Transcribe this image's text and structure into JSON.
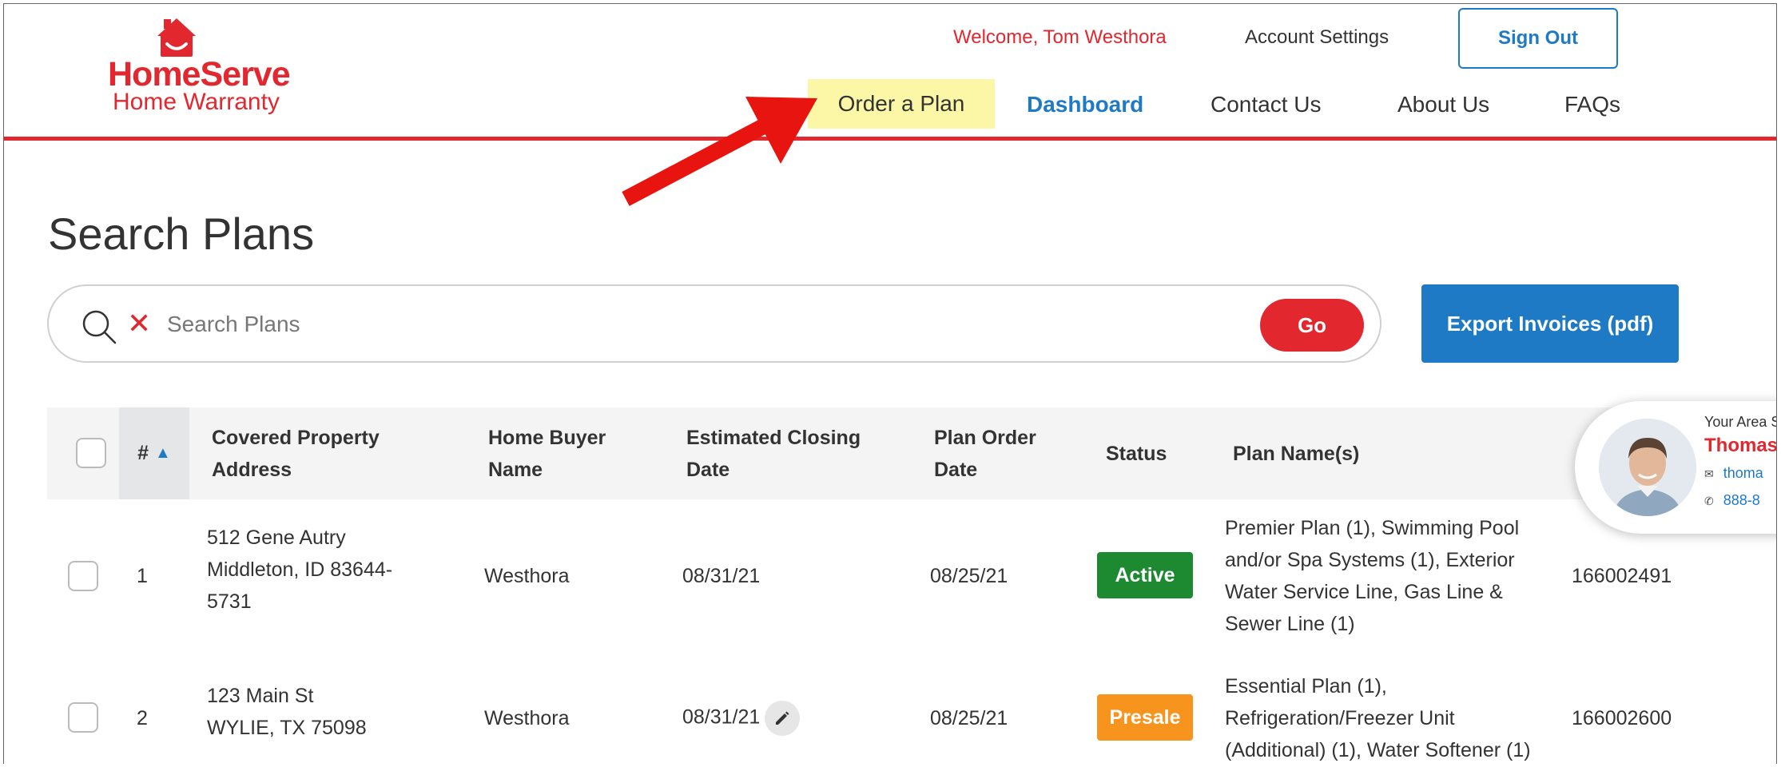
{
  "logo": {
    "name": "HomeServe",
    "tagline": "Home Warranty"
  },
  "header": {
    "welcome": "Welcome, Tom Westhora",
    "account_settings": "Account Settings",
    "sign_out": "Sign Out"
  },
  "nav": {
    "order": "Order a Plan",
    "dashboard": "Dashboard",
    "contact": "Contact Us",
    "about": "About Us",
    "faq": "FAQs"
  },
  "page": {
    "title": "Search Plans",
    "search_placeholder": "Search Plans",
    "go": "Go",
    "export": "Export Invoices (pdf)"
  },
  "table": {
    "headers": {
      "num": "#",
      "address": [
        "Covered Property",
        "Address"
      ],
      "buyer": [
        "Home Buyer",
        "Name"
      ],
      "closing": [
        "Estimated Closing",
        "Date"
      ],
      "order": [
        "Plan Order",
        "Date"
      ],
      "status": "Status",
      "plans": "Plan Name(s)"
    },
    "rows": [
      {
        "num": "1",
        "address": [
          "512 Gene Autry",
          "Middleton, ID 83644-",
          "5731"
        ],
        "buyer": "Westhora",
        "closing": "08/31/21",
        "order": "08/25/21",
        "status": "Active",
        "plans": [
          "Premier Plan (1), Swimming Pool",
          "and/or Spa Systems (1), Exterior",
          "Water Service Line, Gas Line &",
          "Sewer Line (1)"
        ],
        "plan_number": "166002491"
      },
      {
        "num": "2",
        "address": [
          "123 Main St",
          "WYLIE, TX 75098"
        ],
        "buyer": "Westhora",
        "closing": "08/31/21",
        "order": "08/25/21",
        "status": "Presale",
        "plans": [
          "Essential Plan (1),",
          "Refrigeration/Freezer Unit",
          "(Additional) (1), Water Softener (1)"
        ],
        "plan_number": "166002600"
      }
    ]
  },
  "rep": {
    "label": "Your Area S",
    "name": "Thomas",
    "email": "thoma",
    "phone": "888-8"
  },
  "colors": {
    "brand_red": "#e2272f",
    "link_blue": "#1f7ac6",
    "active_green": "#1d8a32",
    "presale_orange": "#f7941d",
    "highlight": "#fbf7a6"
  }
}
